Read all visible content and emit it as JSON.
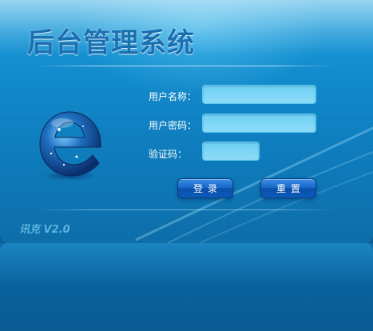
{
  "app": {
    "title": "后台管理系统",
    "version": "讯克 V2.0"
  },
  "form": {
    "username_label": "用户名称：",
    "username_value": "",
    "password_label": "用户密码：",
    "password_value": "",
    "captcha_label": "验证码：",
    "captcha_value": ""
  },
  "buttons": {
    "login": "登录",
    "reset": "重置"
  },
  "logo": {
    "icon": "ie-globe-icon"
  },
  "colors": {
    "panel": "#1591d2",
    "title": "#1a6fb0",
    "field": "#8ddcf8",
    "button": "#1464c4",
    "version": "#5fb3df"
  }
}
